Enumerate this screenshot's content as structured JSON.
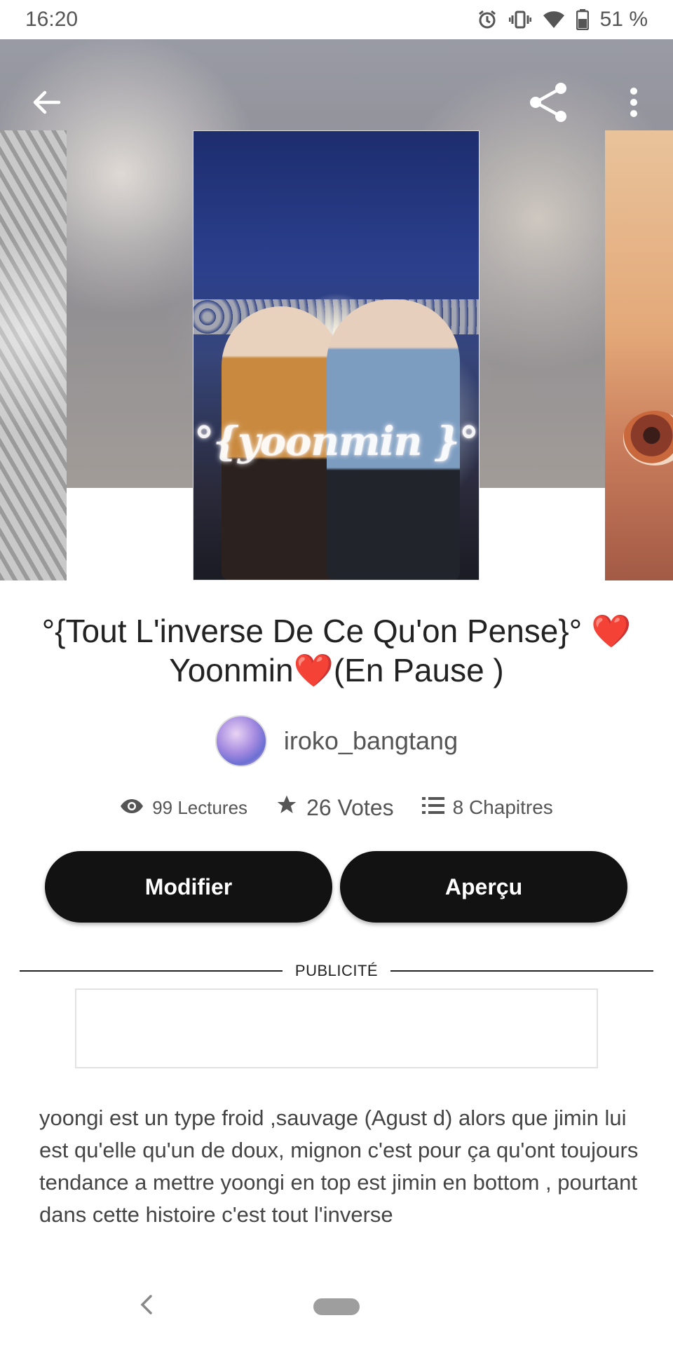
{
  "status_bar": {
    "time": "16:20",
    "battery": "51 %",
    "icons": [
      "alarm-icon",
      "vibrate-icon",
      "wifi-icon",
      "battery-icon"
    ]
  },
  "header": {
    "back_icon": "arrow-left-icon",
    "share_icon": "share-icon",
    "more_icon": "more-vertical-icon"
  },
  "cover": {
    "text": "°{yoonmin }°"
  },
  "story": {
    "title_part1": "°{Tout L'inverse De Ce Qu'on Pense}° ",
    "heart": "❤️",
    "title_part2": "Yoonmin",
    "title_part3": "(En Pause )"
  },
  "author": {
    "name": "iroko_bangtang"
  },
  "stats": {
    "reads": "99 Lectures",
    "votes": "26 Votes",
    "parts": "8 Chapitres"
  },
  "actions": {
    "edit_label": "Modifier",
    "preview_label": "Aperçu"
  },
  "ad": {
    "label": "PUBLICITÉ"
  },
  "description": "yoongi est un type froid ,sauvage (Agust d) alors que jimin lui est qu'elle qu'un de doux, mignon c'est pour ça qu'ont toujours tendance a mettre yoongi en top est jimin en bottom , pourtant dans cette histoire c'est tout l'inverse",
  "colors": {
    "button_bg": "#121212",
    "heart": "#d8202a",
    "text_primary": "#222222",
    "text_secondary": "#555555"
  }
}
